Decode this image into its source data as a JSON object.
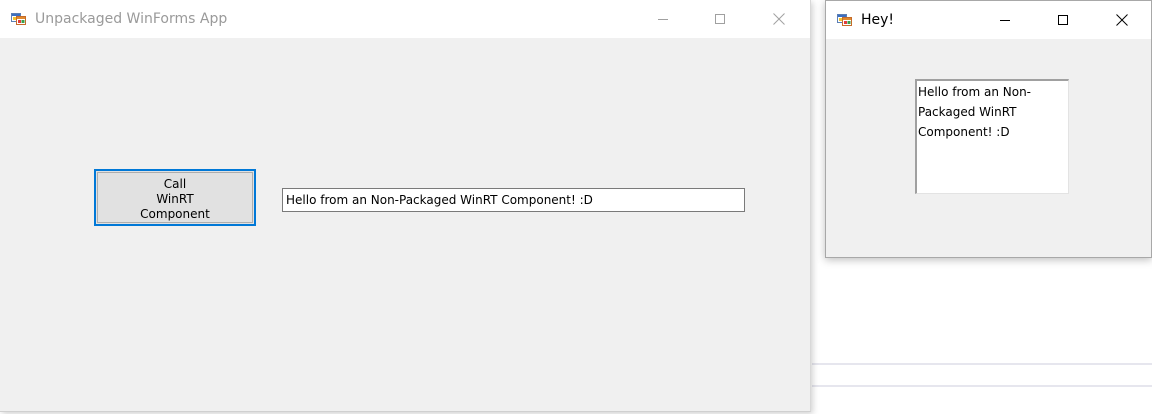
{
  "main_window": {
    "title": "Unpackaged WinForms App",
    "icon": "winforms-app-icon",
    "call_button": {
      "line1": "Call",
      "line2": "WinRT",
      "line3": "Component"
    },
    "result_text": "Hello from an Non-Packaged WinRT Component! :D"
  },
  "dialog_window": {
    "title": "Hey!",
    "icon": "winforms-app-icon",
    "message": {
      "line1": "Hello from an Non-",
      "line2": "Packaged WinRT",
      "line3": "Component! :D"
    }
  },
  "colors": {
    "accent": "#0078d7",
    "inactive_title": "#9a9a9a",
    "window_face": "#f0f0f0"
  }
}
